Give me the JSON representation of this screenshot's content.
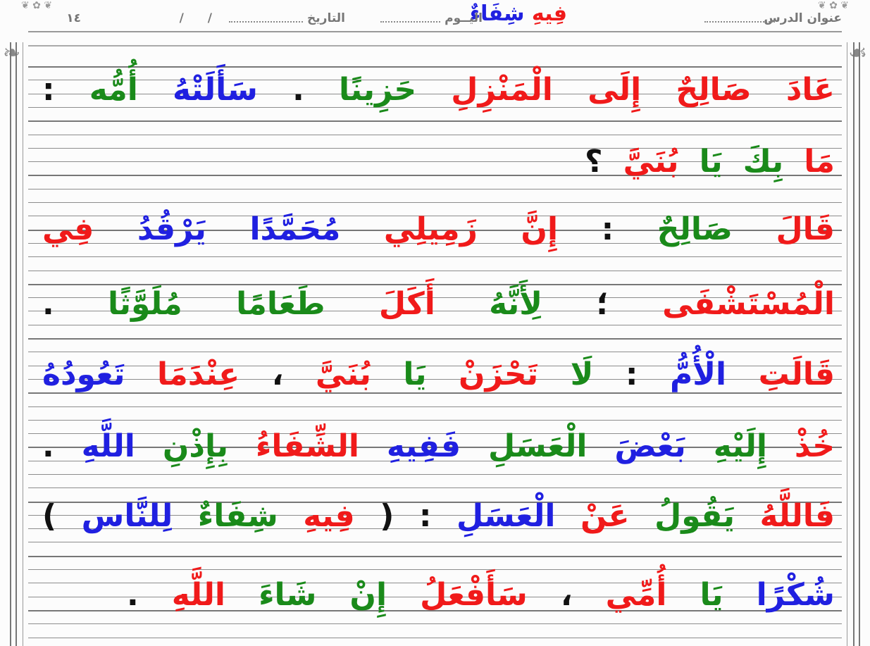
{
  "header": {
    "lesson_label": "عنوان الدرس",
    "title": "فِيهِ شِفَاءٌ",
    "day_label": "اليــوم",
    "date_label": "التاريخ",
    "date_value": "/ /",
    "year": "١٤"
  },
  "colors": {
    "red": "#f01a1a",
    "green": "#1a8a1a",
    "blue": "#2020e0",
    "black": "#111111"
  },
  "lines": [
    {
      "words": [
        {
          "text": "عَادَ",
          "color": "red"
        },
        {
          "text": "صَالِحٌ",
          "color": "red"
        },
        {
          "text": "إِلَى",
          "color": "red"
        },
        {
          "text": "الْمَنْزِلِ",
          "color": "red"
        },
        {
          "text": "حَزِينًا",
          "color": "green"
        },
        {
          "text": ".",
          "color": "black"
        },
        {
          "text": "سَأَلَتْهُ",
          "color": "blue"
        },
        {
          "text": "أُمُّه",
          "color": "green"
        },
        {
          "text": ":",
          "color": "black"
        }
      ]
    },
    {
      "words": [
        {
          "text": "مَا",
          "color": "red"
        },
        {
          "text": "بِكَ",
          "color": "green"
        },
        {
          "text": "يَا",
          "color": "green"
        },
        {
          "text": "بُنَيَّ",
          "color": "red"
        },
        {
          "text": "؟",
          "color": "black"
        }
      ]
    },
    {
      "words": [
        {
          "text": "قَالَ",
          "color": "red"
        },
        {
          "text": "صَالِحٌ",
          "color": "green"
        },
        {
          "text": ":",
          "color": "black"
        },
        {
          "text": "إِنَّ",
          "color": "red"
        },
        {
          "text": "زَمِيلِي",
          "color": "red"
        },
        {
          "text": "مُحَمَّدًا",
          "color": "blue"
        },
        {
          "text": "يَرْقُدُ",
          "color": "blue"
        },
        {
          "text": "فِي",
          "color": "red"
        }
      ]
    },
    {
      "words": [
        {
          "text": "الْمُسْتَشْفَى",
          "color": "red"
        },
        {
          "text": "؛",
          "color": "black"
        },
        {
          "text": "لِأَنَّهُ",
          "color": "green"
        },
        {
          "text": "أَكَلَ",
          "color": "red"
        },
        {
          "text": "طَعَامًا",
          "color": "green"
        },
        {
          "text": "مُلَوَّثًا",
          "color": "green"
        },
        {
          "text": ".",
          "color": "black"
        }
      ]
    },
    {
      "words": [
        {
          "text": "قَالَتِ",
          "color": "red"
        },
        {
          "text": "الْأُمُّ",
          "color": "blue"
        },
        {
          "text": ":",
          "color": "black"
        },
        {
          "text": "لَا",
          "color": "green"
        },
        {
          "text": "تَحْزَنْ",
          "color": "red"
        },
        {
          "text": "يَا",
          "color": "green"
        },
        {
          "text": "بُنَيَّ",
          "color": "red"
        },
        {
          "text": "،",
          "color": "black"
        },
        {
          "text": "عِنْدَمَا",
          "color": "red"
        },
        {
          "text": "تَعُودُهُ",
          "color": "blue"
        }
      ]
    },
    {
      "words": [
        {
          "text": "خُذْ",
          "color": "red"
        },
        {
          "text": "إِلَيْهِ",
          "color": "green"
        },
        {
          "text": "بَعْضَ",
          "color": "blue"
        },
        {
          "text": "الْعَسَلِ",
          "color": "green"
        },
        {
          "text": "فَفِيهِ",
          "color": "blue"
        },
        {
          "text": "الشِّفَاءُ",
          "color": "red"
        },
        {
          "text": "بِإِذْنِ",
          "color": "green"
        },
        {
          "text": "اللَّهِ",
          "color": "blue"
        },
        {
          "text": ".",
          "color": "black"
        }
      ]
    },
    {
      "words": [
        {
          "text": "فَاللَّهُ",
          "color": "red"
        },
        {
          "text": "يَقُولُ",
          "color": "green"
        },
        {
          "text": "عَنْ",
          "color": "red"
        },
        {
          "text": "الْعَسَلِ",
          "color": "blue"
        },
        {
          "text": ":",
          "color": "black"
        },
        {
          "text": "(",
          "color": "black"
        },
        {
          "text": "فِيهِ",
          "color": "red"
        },
        {
          "text": "شِفَاءٌ",
          "color": "green"
        },
        {
          "text": "لِلنَّاس",
          "color": "blue"
        },
        {
          "text": ")",
          "color": "black"
        }
      ]
    },
    {
      "words": [
        {
          "text": "شُكْرًا",
          "color": "blue"
        },
        {
          "text": "يَا",
          "color": "green"
        },
        {
          "text": "أُمِّي",
          "color": "red"
        },
        {
          "text": "،",
          "color": "black"
        },
        {
          "text": "سَأَفْعَلُ",
          "color": "red"
        },
        {
          "text": "إِنْ",
          "color": "green"
        },
        {
          "text": "شَاءَ",
          "color": "green"
        },
        {
          "text": "اللَّهِ",
          "color": "red"
        },
        {
          "text": ".",
          "color": "black"
        }
      ]
    }
  ]
}
